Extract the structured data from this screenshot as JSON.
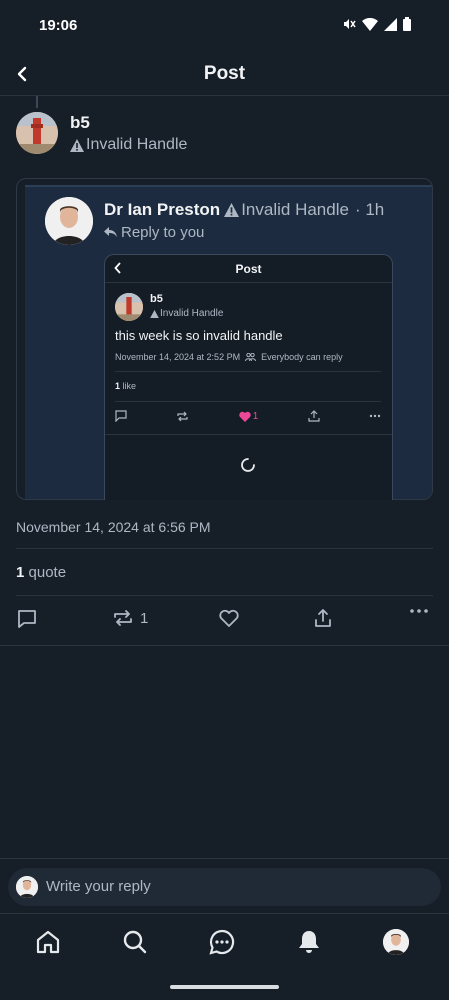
{
  "status_bar": {
    "time": "19:06"
  },
  "header": {
    "title": "Post"
  },
  "post": {
    "author_name": "b5",
    "author_handle": "Invalid Handle",
    "date": "November 14, 2024 at 6:56 PM",
    "quote_count": "1",
    "quote_label": "quote",
    "repost_count": "1"
  },
  "quoted_post": {
    "author_name": "Dr Ian Preston",
    "author_handle": "Invalid Handle",
    "time_ago": "· 1h",
    "reply_label": "Reply to you",
    "embed": {
      "title": "Post",
      "author_name": "b5",
      "author_handle": "Invalid Handle",
      "body": "this week is so invalid handle",
      "date": "November 14, 2024 at 2:52 PM",
      "audience": "Everybody can reply",
      "likes_count": "1",
      "likes_label": "like",
      "heart_count": "1"
    }
  },
  "reply": {
    "placeholder": "Write your reply"
  },
  "colors": {
    "background": "#161e27",
    "card": "#1c2b3f",
    "heart": "#ec4899",
    "muted": "#aeb8c4"
  }
}
